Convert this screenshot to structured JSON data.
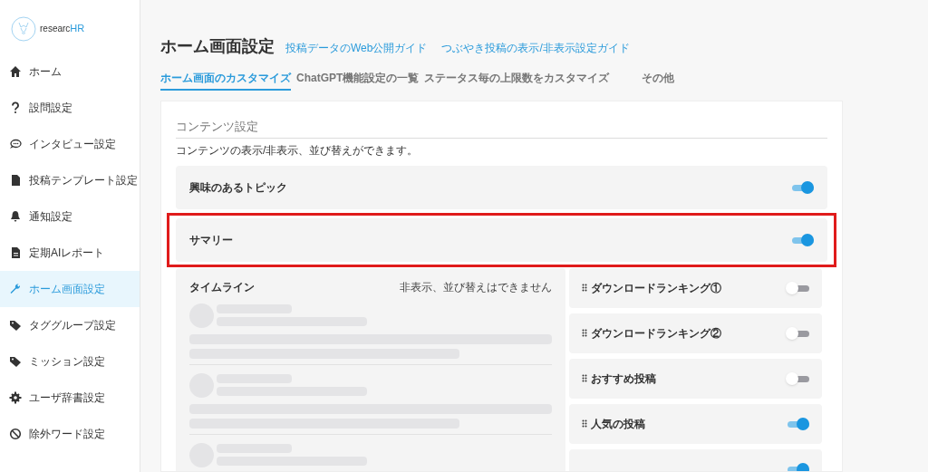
{
  "logo": {
    "text_a": "researc",
    "text_b": "HR"
  },
  "sidebar": {
    "items": [
      {
        "kind": "home",
        "label": "ホーム",
        "selected": false
      },
      {
        "kind": "question",
        "label": "設問設定",
        "selected": false
      },
      {
        "kind": "chat",
        "label": "インタビュー設定",
        "selected": false
      },
      {
        "kind": "file",
        "label": "投稿テンプレート設定",
        "selected": false
      },
      {
        "kind": "bell",
        "label": "通知設定",
        "selected": false
      },
      {
        "kind": "report",
        "label": "定期AIレポート",
        "selected": false
      },
      {
        "kind": "wrench",
        "label": "ホーム画面設定",
        "selected": true
      },
      {
        "kind": "tag",
        "label": "タググループ設定",
        "selected": false
      },
      {
        "kind": "tag",
        "label": "ミッション設定",
        "selected": false
      },
      {
        "kind": "gear",
        "label": "ユーザ辞書設定",
        "selected": false
      },
      {
        "kind": "ban",
        "label": "除外ワード設定",
        "selected": false
      }
    ]
  },
  "header": {
    "title": "ホーム画面設定",
    "links": [
      "投稿データのWeb公開ガイド",
      "つぶやき投稿の表示/非表示設定ガイド"
    ]
  },
  "tabs": [
    {
      "label": "ホーム画面のカスタマイズ",
      "selected": true
    },
    {
      "label": "ChatGPT機能設定の一覧",
      "selected": false
    },
    {
      "label": "ステータス毎の上限数をカスタマイズ",
      "selected": false
    },
    {
      "label": "その他",
      "selected": false
    }
  ],
  "content": {
    "heading": "コンテンツ設定",
    "description": "コンテンツの表示/非表示、並び替えができます。",
    "fixed_rows": [
      {
        "label": "興味のあるトピック",
        "on": true,
        "highlighted": false
      },
      {
        "label": "サマリー",
        "on": true,
        "highlighted": true
      }
    ],
    "timeline": {
      "title": "タイムライン",
      "note": "非表示、並び替えはできません"
    },
    "widgets": [
      {
        "label": "ダウンロードランキング①",
        "on": false
      },
      {
        "label": "ダウンロードランキング②",
        "on": false
      },
      {
        "label": "おすすめ投稿",
        "on": false
      },
      {
        "label": "人気の投稿",
        "on": true
      },
      {
        "on": true
      }
    ]
  }
}
